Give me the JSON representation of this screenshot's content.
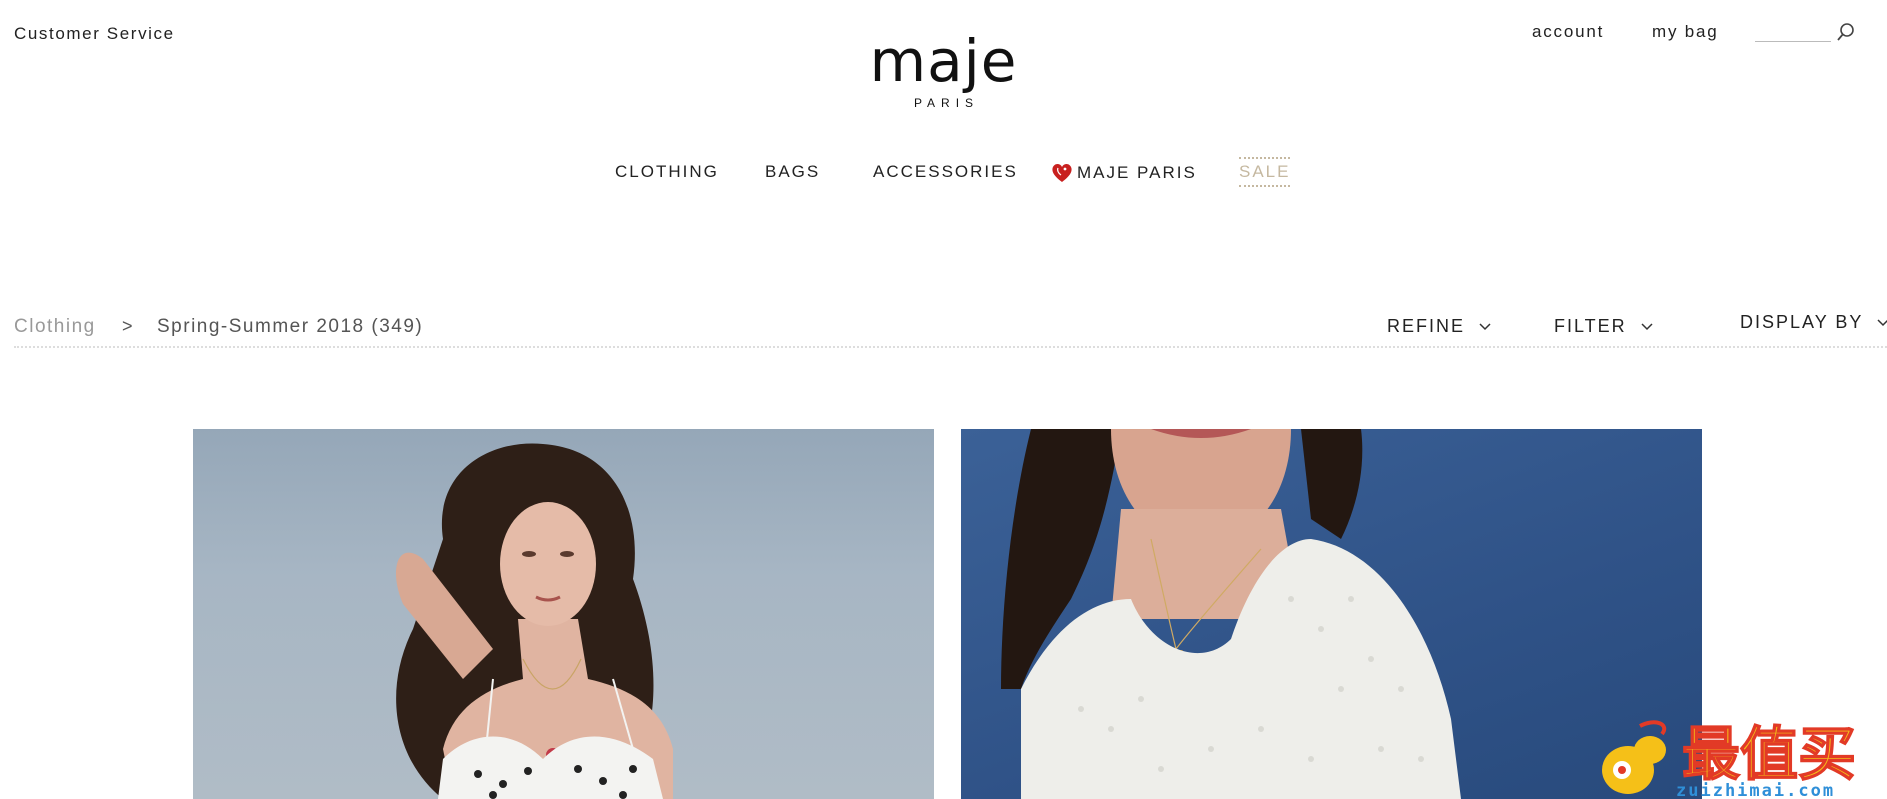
{
  "header": {
    "customer_service": "Customer Service",
    "logo": {
      "word": "maje",
      "sub": "PARIS"
    },
    "account": "account",
    "bag": "my bag",
    "search": {
      "value": "",
      "placeholder": ""
    }
  },
  "nav": {
    "items": [
      {
        "label": "CLOTHING"
      },
      {
        "label": "BAGS"
      },
      {
        "label": "ACCESSORIES"
      },
      {
        "label": "MAJE PARIS",
        "icon": "heart-icon"
      },
      {
        "label": "SALE"
      }
    ]
  },
  "breadcrumb": {
    "root": "Clothing",
    "separator": ">",
    "current": "Spring-Summer 2018 (349)"
  },
  "toolbar": {
    "refine": "REFINE",
    "filter": "FILTER",
    "display_by": "DISPLAY BY"
  },
  "products": [
    {
      "image": "model-polka-dot-top-photo"
    },
    {
      "image": "model-white-blouse-photo"
    }
  ],
  "watermark": {
    "chars": "最值买",
    "url": "zuizhimai.com"
  },
  "colors": {
    "sale": "#c5b8a0",
    "photo1_bg": "#a7b6c4",
    "photo2_bg": "#2f5287",
    "watermark_yellow": "#f5c018",
    "watermark_red": "#e23a26"
  }
}
